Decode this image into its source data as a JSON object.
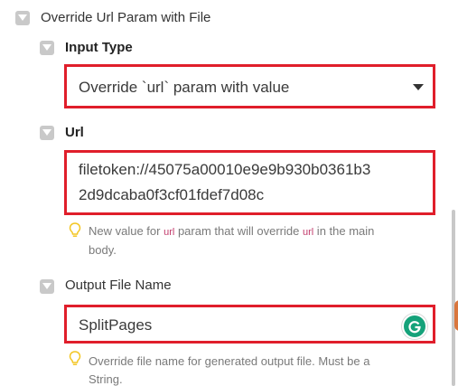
{
  "override_section": {
    "label": "Override Url Param with File"
  },
  "input_type": {
    "label": "Input Type",
    "selected": "Override `url` param with value"
  },
  "url": {
    "label": "Url",
    "value_line1": "filetoken://45075a00010e9e9b930b0361b3",
    "value_line2": "2d9dcaba0f3cf01fdef7d08c",
    "help": {
      "part1": "New value for ",
      "code1": "url",
      "part2": " param that will override ",
      "code2": "url",
      "part3": " in the main",
      "line2": "body."
    }
  },
  "output_file_name": {
    "label": "Output File Name",
    "value": "SplitPages",
    "help_line1": "Override file name for generated output file. Must be a",
    "help_line2": "String."
  },
  "icons": {
    "checkbox": "checkbox-collapse-icon",
    "dropdown": "caret-down-icon",
    "hint": "lightbulb-icon",
    "grammarly": "grammarly-icon"
  },
  "colors": {
    "highlight_border": "#e01e2b",
    "checkbox": "#c9c9c9",
    "hint_bulb": "#f3c623",
    "code_text": "#c23b6b",
    "grammarly": "#15a27a"
  }
}
